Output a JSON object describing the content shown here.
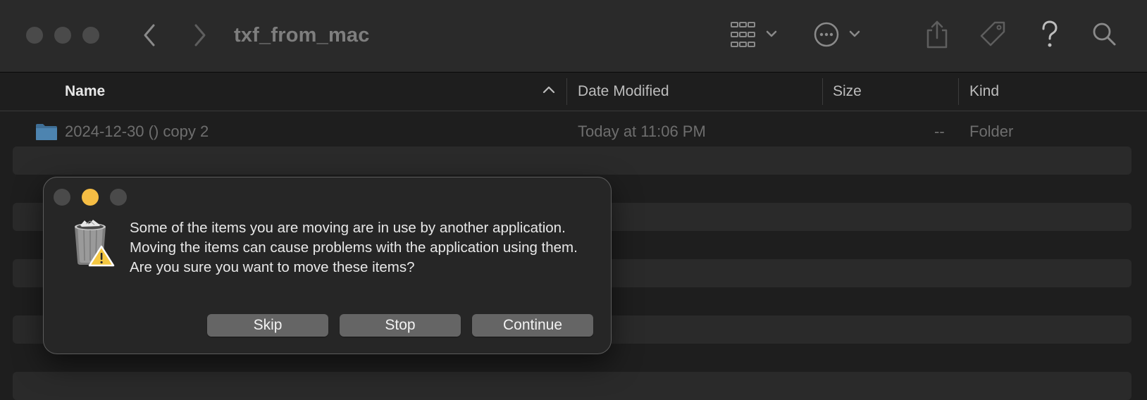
{
  "window": {
    "title": "txf_from_mac"
  },
  "toolbar": {
    "icons": [
      "back-icon",
      "forward-icon",
      "view-grid-icon",
      "more-options-icon",
      "share-icon",
      "tag-icon",
      "help-icon",
      "search-icon"
    ]
  },
  "columns": {
    "name": "Name",
    "date_modified": "Date Modified",
    "size": "Size",
    "kind": "Kind"
  },
  "files": [
    {
      "name": "2024-12-30 () copy 2",
      "date_modified": "Today at 11:06 PM",
      "size": "--",
      "kind": "Folder",
      "icon": "folder-icon"
    }
  ],
  "dialog": {
    "message": "Some of the items you are moving are in use by another application. Moving the items can cause problems with the application using them. Are you sure you want to move these items?",
    "buttons": {
      "skip": "Skip",
      "stop": "Stop",
      "continue": "Continue"
    },
    "icon": "trash-warning-icon"
  },
  "colors": {
    "window_bg": "#1e1e1e",
    "toolbar_bg": "#2a2a2a",
    "dialog_bg": "#262626",
    "button_bg": "#656565",
    "minimize_yellow": "#f5bd44",
    "folder_blue": "#4a7fa8"
  }
}
